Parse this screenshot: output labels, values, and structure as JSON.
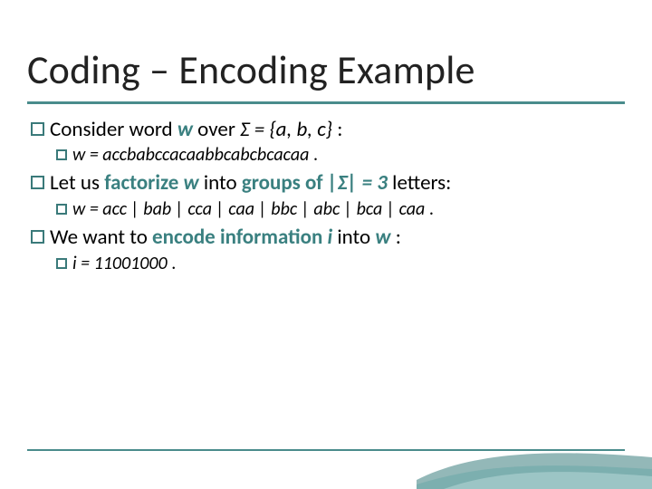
{
  "title": "Coding – Encoding Example",
  "bullets": {
    "b1": {
      "lead": "Consider word ",
      "w": "w",
      "over": "  over  ",
      "sigma": "Σ = {a, b, c}",
      "tail": " :"
    },
    "b1sub": {
      "w": "w = accbabccacaabbcabcbcacaa",
      "dot": " ."
    },
    "b2": {
      "lead": "Let us ",
      "factorize": "factorize ",
      "w": "w",
      "into": "  into ",
      "groups": "groups of ",
      "sig3": "|Σ| = 3",
      "letters": "  letters:"
    },
    "b2sub": {
      "w": "w = acc | bab | cca | caa | bbc | abc | bca | caa",
      "dot": " ."
    },
    "b3": {
      "lead": "We want to ",
      "encode": "encode information ",
      "i": "i",
      "into": "  into ",
      "w": "w",
      "tail": " :"
    },
    "b3sub": {
      "i": "i = 11001000",
      "dot": " ."
    }
  }
}
